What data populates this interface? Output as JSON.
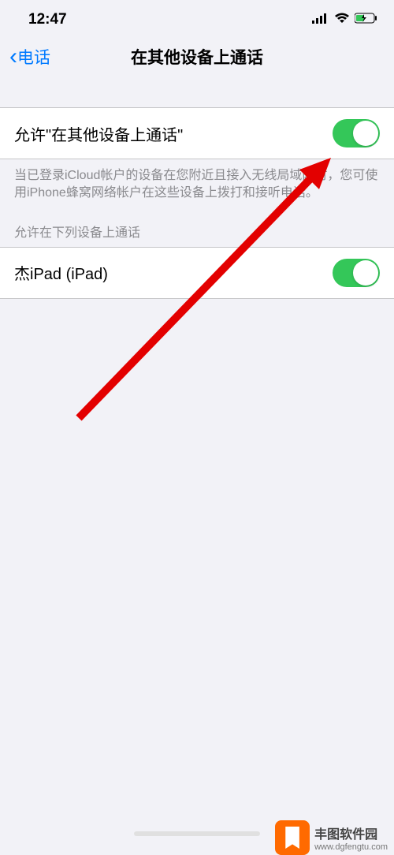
{
  "status_bar": {
    "time": "12:47"
  },
  "nav": {
    "back_label": "电话",
    "title": "在其他设备上通话"
  },
  "main_toggle": {
    "label": "允许\"在其他设备上通话\"",
    "enabled": true,
    "footer": "当已登录iCloud帐户的设备在您附近且接入无线局域网时，您可使用iPhone蜂窝网络帐户在这些设备上拨打和接听电话。"
  },
  "devices_section": {
    "header": "允许在下列设备上通话",
    "items": [
      {
        "label": "杰iPad (iPad)",
        "enabled": true
      }
    ]
  },
  "watermark": {
    "main": "丰图软件园",
    "sub": "www.dgfengtu.com"
  }
}
